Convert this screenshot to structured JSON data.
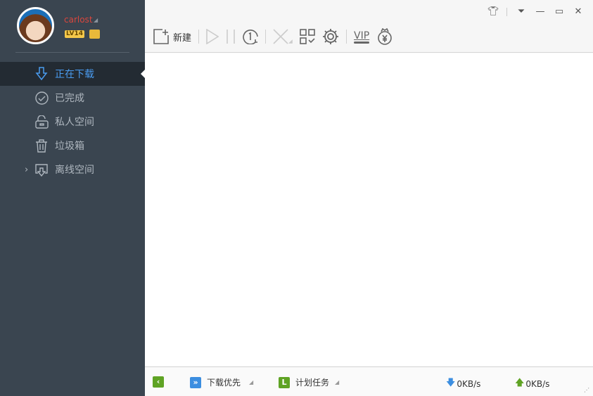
{
  "user": {
    "name": "carlost",
    "level": "LV14"
  },
  "sidebar": {
    "items": [
      {
        "label": "正在下载",
        "icon": "download-icon",
        "active": true
      },
      {
        "label": "已完成",
        "icon": "check-circle-icon"
      },
      {
        "label": "私人空间",
        "icon": "lock-icon"
      },
      {
        "label": "垃圾箱",
        "icon": "trash-icon"
      },
      {
        "label": "离线空间",
        "icon": "cloud-download-icon"
      }
    ]
  },
  "toolbar": {
    "new_label": "新建",
    "vip_label": "VIP"
  },
  "status": {
    "priority_label": "下载优先",
    "schedule_label": "计划任务",
    "down_speed": "0KB/s",
    "up_speed": "0KB/s"
  },
  "colors": {
    "accent": "#4a9cf0",
    "sidebar": "#3a4550",
    "green": "#5fa324",
    "blue": "#3c8ee0"
  }
}
